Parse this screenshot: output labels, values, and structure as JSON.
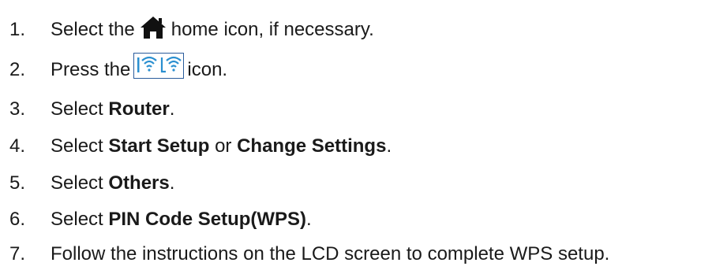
{
  "steps": [
    {
      "number": "1.",
      "pre": "Select the",
      "icon": "home-icon",
      "post": "home icon, if necessary."
    },
    {
      "number": "2.",
      "pre": "Press the",
      "icon": "wifi-status-icon",
      "post": "icon."
    },
    {
      "number": "3.",
      "pre": "Select",
      "bold1": "Router",
      "post": "."
    },
    {
      "number": "4.",
      "pre": "Select",
      "bold1": "Start Setup",
      "mid": "or",
      "bold2": "Change Settings",
      "post": "."
    },
    {
      "number": "5.",
      "pre": "Select",
      "bold1": "Others",
      "post": "."
    },
    {
      "number": "6.",
      "pre": "Select",
      "bold1": "PIN Code Setup(WPS)",
      "post": "."
    },
    {
      "number": "7.",
      "text": "Follow the instructions on the LCD screen to complete WPS setup."
    }
  ],
  "colors": {
    "text": "#1a1a1a",
    "icon_dark": "#111111",
    "wifi_icon": "#2a8fd0",
    "wifi_border": "#2a5c9c"
  }
}
